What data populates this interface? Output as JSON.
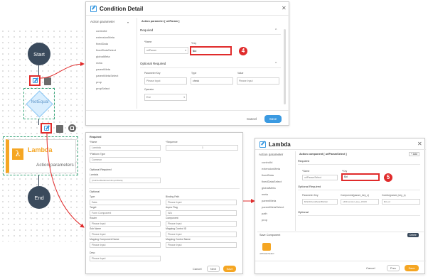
{
  "flow": {
    "start_label": "Start",
    "condition_label": "NotEqual",
    "lambda_title": "Lambda",
    "lambda_subtitle": "Action parameters",
    "end_label": "End",
    "colors": {
      "node": "#3a4a5c",
      "lambda_accent": "#f5a623",
      "highlight": "#e02b2b",
      "arrow": "#e02b2b"
    },
    "icons": [
      "edit-icon",
      "trash-icon",
      "copy-icon",
      "more-icon"
    ]
  },
  "condition_dialog": {
    "title": "Condition Detail",
    "side_header": "Action parameter",
    "side_items": [
      "controlId",
      "extensionMeta",
      "fixedData",
      "fixedDataSelect",
      "globalMeta",
      "meta",
      "parentMeta",
      "parentMetaSelect",
      "prop",
      "propSelect"
    ],
    "main_header": "Action parameter [ urlParam ]",
    "required_label": "Required",
    "name_label": "*Name",
    "name_value": "urlParam",
    "key_label": "*Key",
    "key_value": "$id",
    "optional_label": "Optional Required",
    "param_key_label": "Parameter Key",
    "type_label": "Type",
    "value_label": "Value",
    "param_key_placeholder": "Please Input",
    "type_value": "check",
    "value_placeholder": "Please Input",
    "operator_label": "Operator",
    "operator_value": "Eve",
    "cancel_label": "Cancel",
    "save_label": "Save",
    "step_number": "4"
  },
  "middle_dialog": {
    "required_label": "Required",
    "name_label": "*Name",
    "name_value": "Lambda",
    "sequence_label": "*Sequence",
    "sequence_value": "1",
    "platform_label": "*Platform Type",
    "platform_value": "Common",
    "optional_required_label": "Optional Required",
    "lambda_label": "Lambda",
    "lambda_value": "{CalcGetMetaInsert4ImportData}",
    "optional_label": "Optional",
    "rows": [
      {
        "left_label": "Type",
        "left_value": "Data",
        "right_label": "Binding Path",
        "right_value": "Please Input"
      },
      {
        "left_label": "Target",
        "left_value": "Form Component",
        "right_label": "Async Flag",
        "right_value": "N/A"
      },
      {
        "left_label": "Router",
        "left_value": "Please Input",
        "right_label": "Component",
        "right_value": "Please Input"
      },
      {
        "left_label": "Sub Name",
        "left_value": "Please Input",
        "right_label": "Mapping Control ID",
        "right_value": "Please Input"
      },
      {
        "left_label": "Mapping Component Name",
        "left_value": "Please Input",
        "right_label": "Mapping Control Name",
        "right_value": "Please Input"
      }
    ],
    "desc_label": "Desc",
    "desc_placeholder": "Please Input",
    "cancel_label": "Cancel",
    "next_label": "Next",
    "save_label": "Save"
  },
  "lambda_dialog": {
    "title": "Lambda",
    "side_header": "Action parameter",
    "side_items": [
      "controlId",
      "extensionMeta",
      "fixedData",
      "fixedDataSelect",
      "globalMeta",
      "meta",
      "parentMeta",
      "parentMetaSelect",
      "path",
      "prop"
    ],
    "main_header": "Action component [ urlParamSelect ]",
    "add_label": "+ Add",
    "required_label": "Required",
    "name_label": "*Name",
    "name_value": "urlParamSelect",
    "key_label": "*Key",
    "key_value": "$id",
    "optional_required_label": "Optional Required",
    "col1_label": "Parameter Key",
    "col2_label": "Component(param_key_c)",
    "col3_label": "Combo(param_key_c)",
    "col1_value": "$ParlibAutoMeta4Builder",
    "col2_value": "o4Dimension_key_19426",
    "col3_value": "$ctl_id",
    "optional_label": "Optional",
    "save_component_label": "Save Component",
    "delete_label": "Delete",
    "component_chip": "urlParamSelect",
    "cancel_label": "Cancel",
    "prev_label": "Prev",
    "save_label": "Save",
    "step_number": "5"
  }
}
